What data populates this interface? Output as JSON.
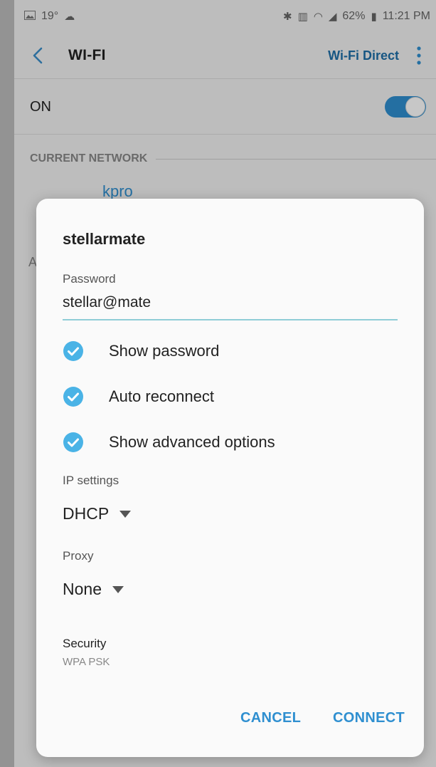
{
  "status_bar": {
    "left_text": "19°",
    "battery": "62%",
    "time": "11:21 PM"
  },
  "app_bar": {
    "title": "WI-FI",
    "wifi_direct_label": "Wi-Fi Direct"
  },
  "wifi_switch": {
    "label": "ON",
    "state": true
  },
  "current_network": {
    "header": "CURRENT NETWORK",
    "name": "kpro"
  },
  "background_partial_text": "A",
  "dialog": {
    "title": "stellarmate",
    "password_label": "Password",
    "password_value": "stellar@mate",
    "options": [
      {
        "label": "Show password",
        "checked": true
      },
      {
        "label": "Auto reconnect",
        "checked": true
      },
      {
        "label": "Show advanced options",
        "checked": true
      }
    ],
    "ip_settings_label": "IP settings",
    "ip_settings_value": "DHCP",
    "proxy_label": "Proxy",
    "proxy_value": "None",
    "security_label": "Security",
    "security_value": "WPA PSK",
    "cancel_label": "CANCEL",
    "connect_label": "CONNECT"
  },
  "colors": {
    "accent": "#2f8fd0",
    "check": "#4ab3e6",
    "field_underline": "#8fcdd6"
  }
}
